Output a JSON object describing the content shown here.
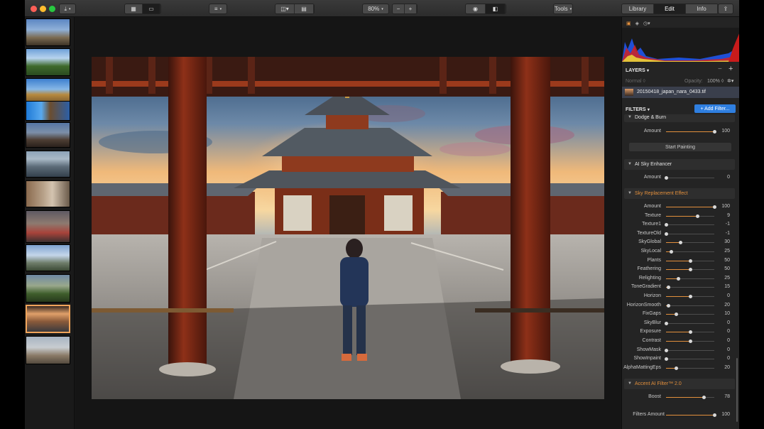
{
  "toolbar": {
    "zoom": "80%",
    "zoom_minus": "−",
    "zoom_plus": "+",
    "tools": "Tools",
    "tabs": [
      "Library",
      "Edit",
      "Info"
    ],
    "active_tab": "Edit"
  },
  "layers": {
    "title": "LAYERS",
    "blend_mode": "Normal",
    "opacity_label": "Opacity:",
    "opacity_value": "100%",
    "file_name": "20150418_japan_nara_0433.tif"
  },
  "filters": {
    "title": "FILTERS",
    "add_button": "+ Add Filter...",
    "dodge_burn": {
      "name": "Dodge & Burn",
      "amount_label": "Amount",
      "amount_value": "100",
      "amount_level": 1.0,
      "start_painting": "Start Painting"
    },
    "ai_sky": {
      "name": "AI Sky Enhancer",
      "amount_label": "Amount",
      "amount_value": "0",
      "amount_level": 0.0
    },
    "sky_replacement": {
      "name": "Sky Replacement Effect",
      "params": [
        {
          "label": "Amount",
          "value": "100",
          "level": 1.0
        },
        {
          "label": "Texture",
          "value": "9",
          "level": 0.65
        },
        {
          "label": "Texture1",
          "value": "-1",
          "level": 0.0
        },
        {
          "label": "TextureOld",
          "value": "-1",
          "level": 0.0
        },
        {
          "label": "SkyGlobal",
          "value": "30",
          "level": 0.3
        },
        {
          "label": "SkyLocal",
          "value": "25",
          "level": 0.1
        },
        {
          "label": "Plants",
          "value": "50",
          "level": 0.5
        },
        {
          "label": "Feathering",
          "value": "50",
          "level": 0.5
        },
        {
          "label": "Relighting",
          "value": "25",
          "level": 0.25
        },
        {
          "label": "ToneGradient",
          "value": "15",
          "level": 0.05
        },
        {
          "label": "Horizon",
          "value": "0",
          "level": 0.5
        },
        {
          "label": "HorizonSmooth",
          "value": "20",
          "level": 0.05
        },
        {
          "label": "FixGaps",
          "value": "10",
          "level": 0.2
        },
        {
          "label": "SkyBlur",
          "value": "0",
          "level": 0.0
        },
        {
          "label": "Exposure",
          "value": "0",
          "level": 0.5
        },
        {
          "label": "Contrast",
          "value": "0",
          "level": 0.5
        },
        {
          "label": "ShowMask",
          "value": "0",
          "level": 0.0
        },
        {
          "label": "ShowInpaint",
          "value": "0",
          "level": 0.0
        },
        {
          "label": "AlphaMattingEps",
          "value": "20",
          "level": 0.2
        }
      ]
    },
    "accent_ai": {
      "name": "Accent AI Filter™ 2.0",
      "boost_label": "Boost",
      "boost_value": "78",
      "boost_level": 0.78
    },
    "filters_amount_label": "Filters Amount",
    "filters_amount_value": "100",
    "filters_amount_level": 1.0
  },
  "colors": {
    "accent": "#e28f3c",
    "blue_button": "#2f7fe0"
  }
}
